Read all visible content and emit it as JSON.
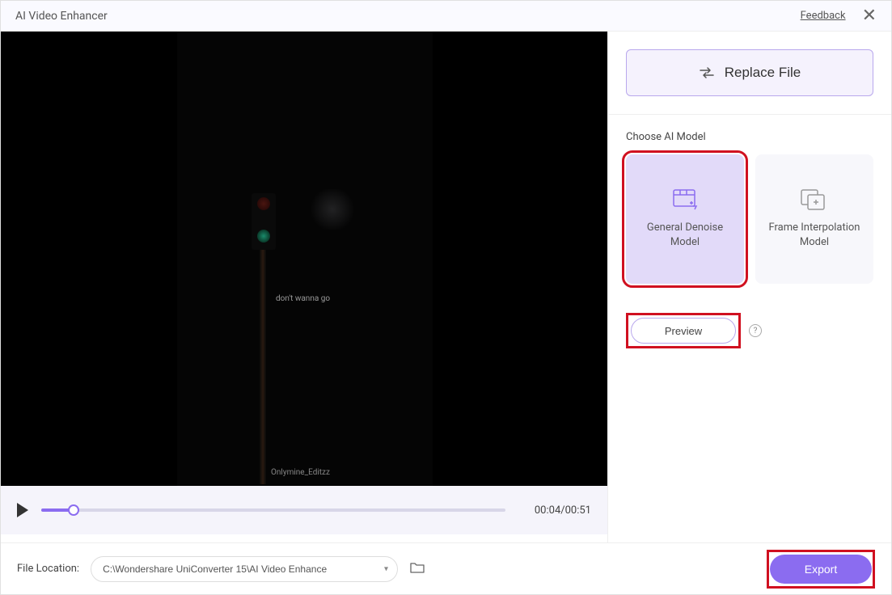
{
  "titlebar": {
    "title": "AI Video Enhancer",
    "feedback": "Feedback"
  },
  "video": {
    "text_overlay_1": "don't wanna go",
    "watermark": "Onlymine_Editzz"
  },
  "player": {
    "current_time": "00:04",
    "duration": "00:51",
    "time_display": "00:04/00:51"
  },
  "sidebar": {
    "replace_label": "Replace File",
    "choose_model_label": "Choose AI Model",
    "models": [
      {
        "name": "General Denoise Model",
        "selected": true
      },
      {
        "name": "Frame Interpolation Model",
        "selected": false
      }
    ],
    "preview_label": "Preview"
  },
  "footer": {
    "file_location_label": "File Location:",
    "file_path": "C:\\Wondershare UniConverter 15\\AI Video Enhance",
    "export_label": "Export"
  }
}
